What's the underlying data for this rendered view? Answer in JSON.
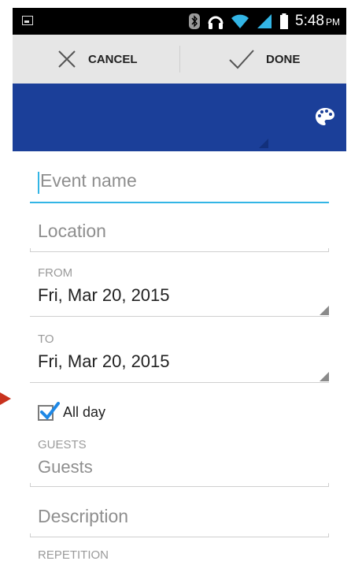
{
  "status_bar": {
    "time": "5:48",
    "ampm": "PM"
  },
  "action_bar": {
    "cancel_label": "CANCEL",
    "done_label": "DONE"
  },
  "form": {
    "event_name_placeholder": "Event name",
    "location_placeholder": "Location",
    "from_label": "FROM",
    "from_value": "Fri, Mar 20, 2015",
    "to_label": "TO",
    "to_value": "Fri, Mar 20, 2015",
    "all_day_label": "All day",
    "all_day_checked": true,
    "guests_label": "GUESTS",
    "guests_placeholder": "Guests",
    "description_placeholder": "Description",
    "repetition_label": "REPETITION"
  },
  "colors": {
    "header_blue": "#1b3f99",
    "accent": "#33b5e5",
    "check_blue": "#1e88e5",
    "annotation_red": "#c8321e"
  },
  "icons": [
    "image-icon",
    "bluetooth-icon",
    "headset-icon",
    "wifi-icon",
    "signal-icon",
    "battery-icon",
    "close-icon",
    "check-icon",
    "palette-icon",
    "dropdown-triangle-icon",
    "checkbox-icon"
  ]
}
